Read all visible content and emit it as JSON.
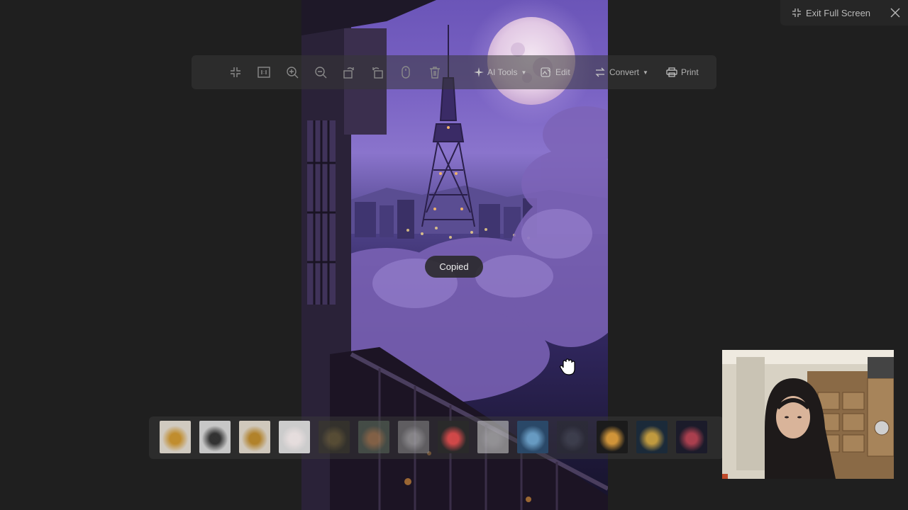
{
  "header": {
    "exit_fullscreen_label": "Exit Full Screen"
  },
  "toolbar": {
    "ai_tools_label": "AI Tools",
    "edit_label": "Edit",
    "convert_label": "Convert",
    "print_label": "Print"
  },
  "toast": {
    "message": "Copied"
  },
  "filmstrip": {
    "thumbnails": [
      {
        "name": "giraffe",
        "bg": "#d9d2c8",
        "accent": "#c8922e"
      },
      {
        "name": "zebra",
        "bg": "#cfcfcf",
        "accent": "#333333"
      },
      {
        "name": "giraffe-2",
        "bg": "#d8d0c4",
        "accent": "#b8862a"
      },
      {
        "name": "bunny",
        "bg": "#d4d4d4",
        "accent": "#efe6e6"
      },
      {
        "name": "forest",
        "bg": "#3b3a2a",
        "accent": "#7a6a3a"
      },
      {
        "name": "path",
        "bg": "#5a6a5a",
        "accent": "#c8905a"
      },
      {
        "name": "sparkle",
        "bg": "#8a8a8a",
        "accent": "#cfcfcf"
      },
      {
        "name": "circles",
        "bg": "#2a2a2a",
        "accent": "#d84a4a"
      },
      {
        "name": "light",
        "bg": "#cfcfcf",
        "accent": "#e8e8e8"
      },
      {
        "name": "ocean",
        "bg": "#2a4a6a",
        "accent": "#6aa0c8"
      },
      {
        "name": "night",
        "bg": "#2a2c34",
        "accent": "#4a4e5a"
      },
      {
        "name": "fireflies",
        "bg": "#1a1a1a",
        "accent": "#d89a3a"
      },
      {
        "name": "stars",
        "bg": "#1a2a3a",
        "accent": "#c8a040"
      },
      {
        "name": "nebula",
        "bg": "#1a1a2a",
        "accent": "#b04050"
      }
    ]
  },
  "colors": {
    "background": "#1f1f1f",
    "toolbar_text": "#d0d0d0",
    "photo_purple": "#6b55b8"
  }
}
